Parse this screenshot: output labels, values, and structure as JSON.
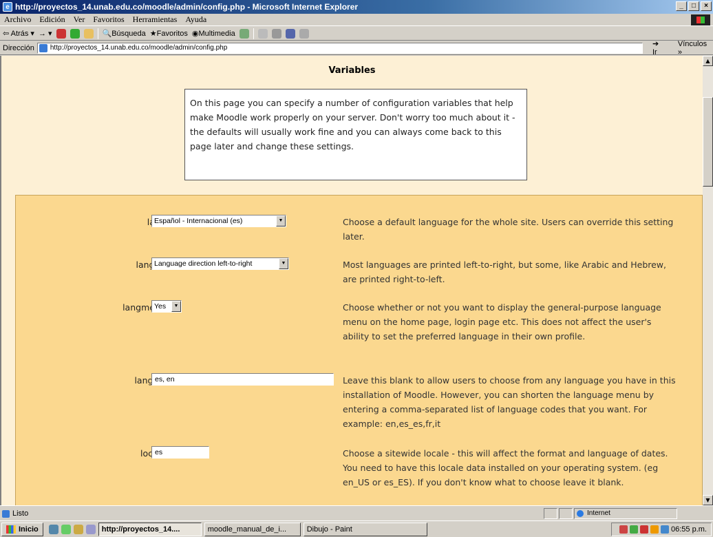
{
  "window": {
    "title": "http://proyectos_14.unab.edu.co/moodle/admin/config.php - Microsoft Internet Explorer",
    "min": "_",
    "max": "□",
    "close": "×"
  },
  "menu": [
    "Archivo",
    "Edición",
    "Ver",
    "Favoritos",
    "Herramientas",
    "Ayuda"
  ],
  "toolbar": {
    "back": "Atrás",
    "search": "Búsqueda",
    "favorites": "Favoritos",
    "multimedia": "Multimedia"
  },
  "address": {
    "label": "Dirección",
    "url": "http://proyectos_14.unab.edu.co/moodle/admin/config.php",
    "go": "Ir",
    "links": "Vínculos »"
  },
  "page": {
    "heading": "Variables",
    "intro": "On this page you can specify a number of configuration variables that help make Moodle work properly on your server. Don't worry too much about it - the defaults will usually work fine and you can always come back to this page later and change these settings.",
    "settings": [
      {
        "name": "lang:",
        "control": "select",
        "value": "Español - Internacional (es)",
        "desc": "Choose a default language for the whole site. Users can override this setting later."
      },
      {
        "name": "langdir:",
        "control": "select",
        "value": "Language direction left-to-right",
        "desc": "Most languages are printed left-to-right, but some, like Arabic and Hebrew, are printed right-to-left."
      },
      {
        "name": "langmenu:",
        "control": "select",
        "value": "Yes",
        "desc": "Choose whether or not you want to display the general-purpose language menu on the home page, login page etc. This does not affect the user's ability to set the preferred language in their own profile."
      },
      {
        "name": "langlist:",
        "control": "text",
        "value": "es, en",
        "desc": "Leave this blank to allow users to choose from any language you have in this installation of Moodle. However, you can shorten the language menu by entering a comma-separated list of language codes that you want. For example: en,es_es,fr,it"
      },
      {
        "name": "locale:",
        "control": "text",
        "value": "es",
        "desc": "Choose a sitewide locale - this will affect the format and language of dates. You need to have this locale data installed on your operating system. (eg en_US or es_ES). If you don't know what to choose leave it blank."
      }
    ]
  },
  "status": {
    "text": "Listo",
    "zone": "Internet"
  },
  "taskbar": {
    "start": "Inicio",
    "tasks": [
      "http://proyectos_14....",
      "moodle_manual_de_i...",
      "Dibujo - Paint"
    ],
    "clock": "06:55 p.m."
  }
}
